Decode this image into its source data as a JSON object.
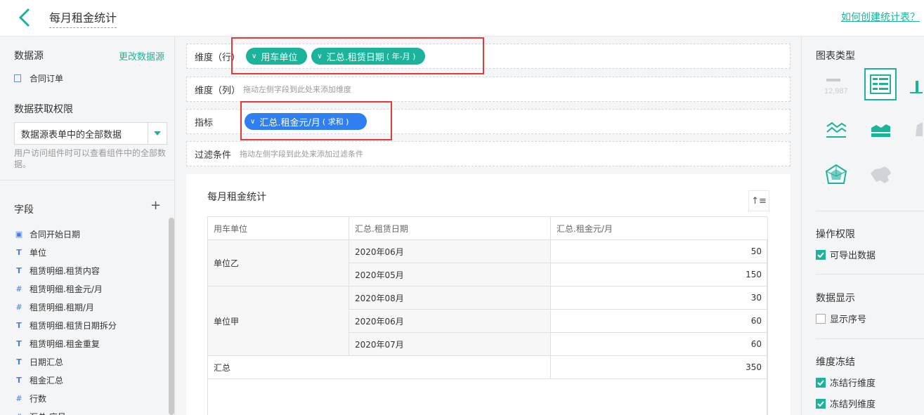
{
  "header": {
    "title": "每月租金统计",
    "help_link": "如何创建统计表？"
  },
  "left": {
    "datasource_title": "数据源",
    "change_datasource": "更改数据源",
    "datasource_item": "合同订单",
    "permission_title": "数据获取权限",
    "permission_value": "数据源表单中的全部数据",
    "permission_note": "用户访问组件时可以查看组件中的全部数据。",
    "fields_title": "字段",
    "fields": [
      {
        "icon": "calendar-icon",
        "label": "合同开始日期"
      },
      {
        "icon": "text-icon",
        "label": "单位"
      },
      {
        "icon": "text-icon",
        "label": "租赁明细.租赁内容"
      },
      {
        "icon": "number-icon",
        "label": "租赁明细.租金元/月"
      },
      {
        "icon": "number-icon",
        "label": "租赁明细.租期/月"
      },
      {
        "icon": "text-icon",
        "label": "租赁明细.租赁日期拆分"
      },
      {
        "icon": "text-icon",
        "label": "租赁明细.租金重复"
      },
      {
        "icon": "text-icon",
        "label": "日期汇总"
      },
      {
        "icon": "text-icon",
        "label": "租金汇总"
      },
      {
        "icon": "number-icon",
        "label": "行数"
      },
      {
        "icon": "number-icon",
        "label": "汇总.序号"
      }
    ]
  },
  "zones": {
    "row_label": "维度（行）",
    "row_pills": [
      {
        "label": "用车单位",
        "sub": ""
      },
      {
        "label": "汇总.租赁日期",
        "sub": "( 年-月 )"
      }
    ],
    "col_label": "维度（列）",
    "col_hint": "拖动左侧字段到此处来添加维度",
    "metric_label": "指标",
    "metric_pill": {
      "label": "汇总.租金元/月",
      "sub": "( 求和 )"
    },
    "filter_label": "过滤条件",
    "filter_hint": "拖动左侧字段到此处来添加过滤条件"
  },
  "table": {
    "title": "每月租金统计",
    "headers": [
      "用车单位",
      "汇总.租赁日期",
      "汇总.租金元/月"
    ],
    "groups": [
      {
        "unit": "单位乙",
        "rows": [
          {
            "date": "2020年06月",
            "value": "50"
          },
          {
            "date": "2020年05月",
            "value": "150"
          }
        ]
      },
      {
        "unit": "单位甲",
        "rows": [
          {
            "date": "2020年08月",
            "value": "30"
          },
          {
            "date": "2020年06月",
            "value": "60"
          },
          {
            "date": "2020年07月",
            "value": "60"
          }
        ]
      }
    ],
    "total_label": "汇总",
    "total_value": "350"
  },
  "right": {
    "chart_type_title": "图表类型",
    "kpi_number": "12,987",
    "op_perm_title": "操作权限",
    "export_label": "可导出数据",
    "export_checked": true,
    "display_title": "数据显示",
    "show_index_label": "显示序号",
    "show_index_checked": false,
    "freeze_title": "维度冻结",
    "freeze_row_label": "冻结行维度",
    "freeze_row_checked": true,
    "freeze_col_label": "冻结列维度",
    "freeze_col_checked": true
  },
  "colors": {
    "accent": "#1bb49b",
    "metric": "#2f7ff0",
    "highlight": "#e53935"
  }
}
